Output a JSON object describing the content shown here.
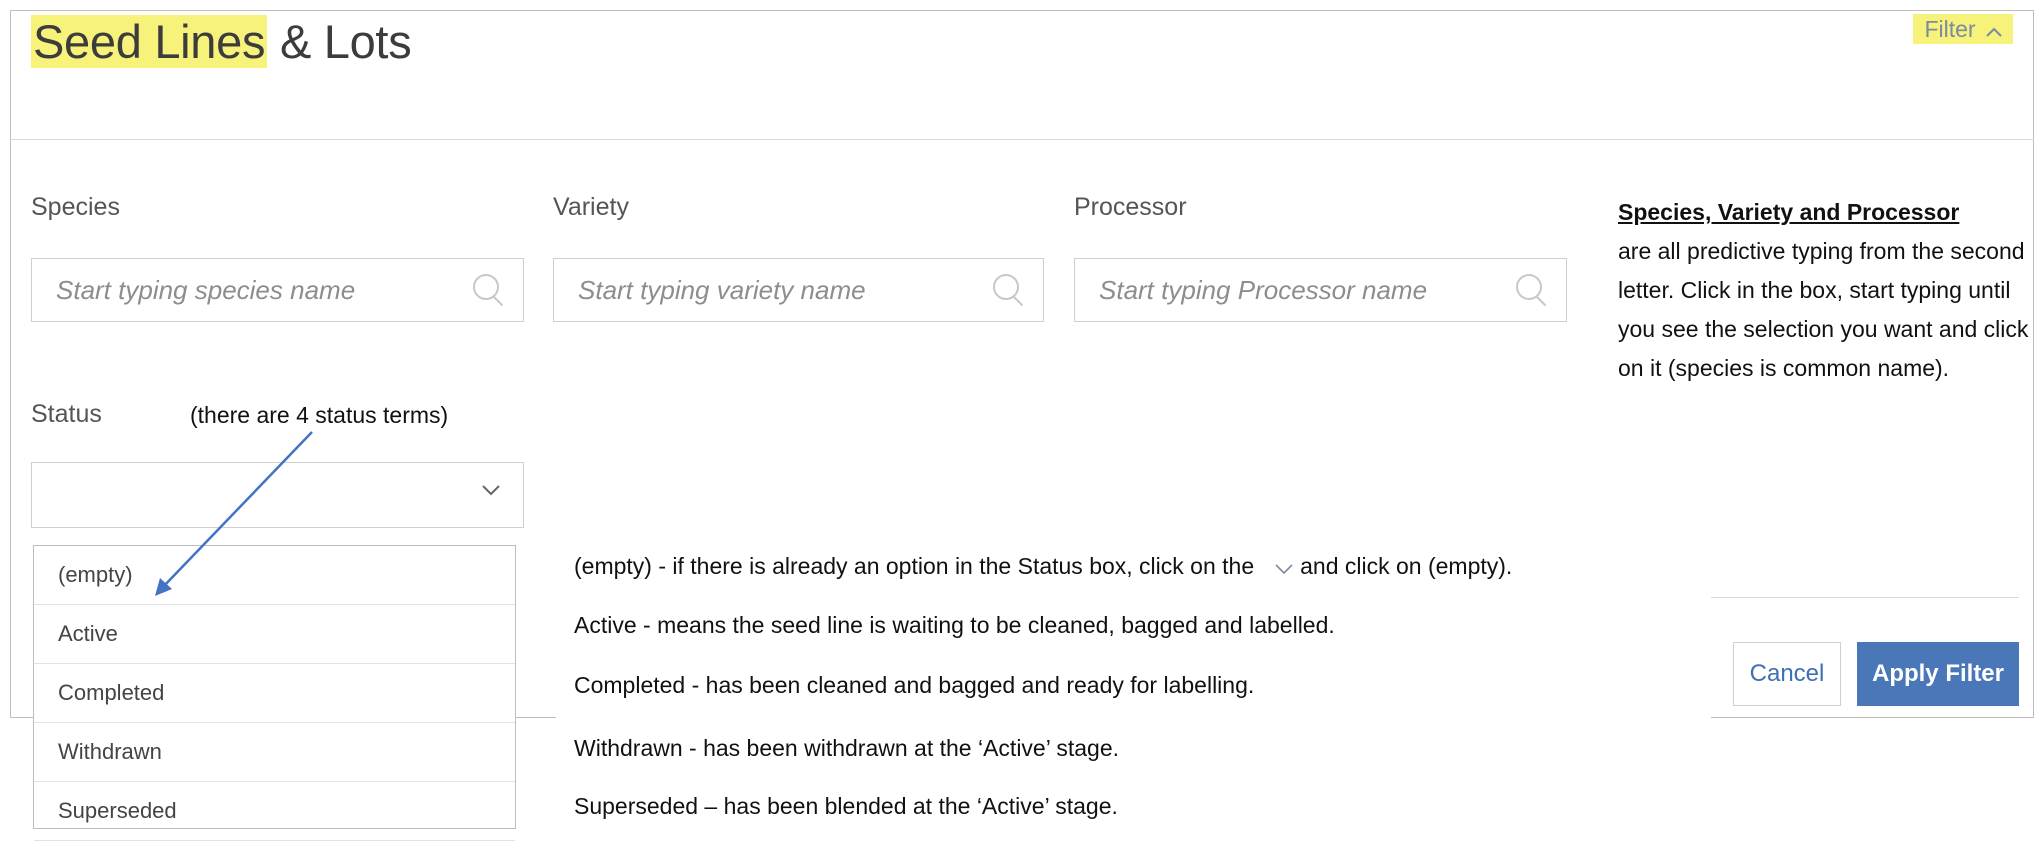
{
  "header": {
    "title_highlighted": "Seed Lines",
    "title_rest": " & Lots",
    "filter_label": "Filter"
  },
  "fields": {
    "species": {
      "label": "Species",
      "placeholder": "Start typing species name"
    },
    "variety": {
      "label": "Variety",
      "placeholder": "Start typing variety name"
    },
    "processor": {
      "label": "Processor",
      "placeholder": "Start typing Processor name"
    },
    "status": {
      "label": "Status",
      "value": ""
    }
  },
  "status_options": [
    "(empty)",
    "Active",
    "Completed",
    "Withdrawn",
    "Superseded"
  ],
  "annotations": {
    "status_note": "(there are 4 status terms)",
    "right_note_title": "Species, Variety and Processor",
    "right_note_body": "are all predictive typing from the second letter.  Click in the box, start typing until you see the selection you want and click on it (species is common name).",
    "empty_desc_before": "(empty) - if there is already an option in the Status box, click on the",
    "empty_desc_after": "and click on (empty).",
    "active_desc": "Active - means the seed line is waiting to be cleaned, bagged and labelled.",
    "completed_desc": "Completed - has been cleaned and bagged and ready for labelling.",
    "withdrawn_desc": "Withdrawn  - has been withdrawn at the ‘Active’ stage.",
    "superseded_desc": "Superseded – has been blended at the ‘Active’ stage."
  },
  "buttons": {
    "cancel": "Cancel",
    "apply": "Apply Filter"
  },
  "colors": {
    "highlight": "#f7f27a",
    "primary": "#4a77b7",
    "link": "#3f6fb5",
    "arrow": "#4472c4"
  }
}
